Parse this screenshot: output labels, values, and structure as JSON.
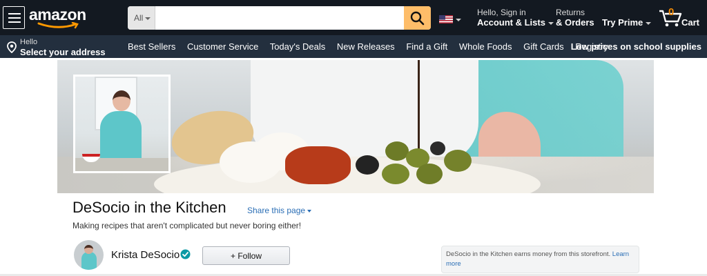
{
  "header": {
    "logo_text": "amazon",
    "search": {
      "category": "All",
      "placeholder": ""
    },
    "account": {
      "greeting": "Hello, Sign in",
      "label": "Account & Lists"
    },
    "orders": {
      "line1": "Returns",
      "line2": "& Orders"
    },
    "prime": "Try Prime",
    "cart": {
      "count": "0",
      "label": "Cart"
    }
  },
  "subnav": {
    "address": {
      "line1": "Hello",
      "line2": "Select your address"
    },
    "links": [
      "Best Sellers",
      "Customer Service",
      "Today's Deals",
      "New Releases",
      "Find a Gift",
      "Whole Foods",
      "Gift Cards",
      "Registry"
    ],
    "promo": "Low prices on school supplies"
  },
  "store": {
    "title": "DeSocio in the Kitchen",
    "share_label": "Share this page",
    "tagline": "Making recipes that aren't complicated but never boring either!",
    "owner_name": "Krista DeSocio",
    "follow_label": "+ Follow",
    "earnings_text": "DeSocio in the Kitchen earns money from this storefront.",
    "learn_more": "Learn more"
  },
  "colors": {
    "nav_bg": "#131921",
    "subnav_bg": "#232f3e",
    "search_button": "#febd69",
    "link": "#2a6eb5",
    "cart_count": "#f08804"
  }
}
